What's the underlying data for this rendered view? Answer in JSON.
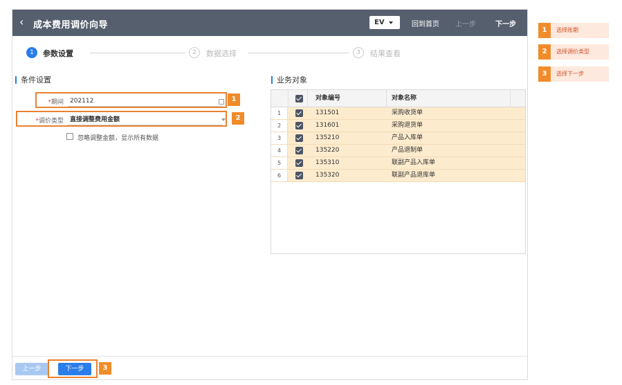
{
  "titlebar": {
    "title": "成本费用调价向导",
    "ev": "EV",
    "home": "回到首页",
    "prev": "上一步",
    "next": "下一步"
  },
  "steps": [
    {
      "num": "1",
      "label": "参数设置",
      "state": "active"
    },
    {
      "num": "2",
      "label": "数据选择",
      "state": "todo"
    },
    {
      "num": "3",
      "label": "结果查看",
      "state": "todo"
    }
  ],
  "conditions": {
    "heading": "条件设置",
    "period_label": "期间",
    "period_value": "202112",
    "type_label": "调价类型",
    "type_value": "直接调整费用金额",
    "req_mark": "*",
    "ignore_label": "忽略调整金额，显示所有数据"
  },
  "objects": {
    "heading": "业务对象",
    "columns": [
      "对象编号",
      "对象名称"
    ],
    "rows": [
      {
        "idx": "1",
        "code": "131501",
        "name": "采购收货单"
      },
      {
        "idx": "2",
        "code": "131601",
        "name": "采购退货单"
      },
      {
        "idx": "3",
        "code": "135210",
        "name": "产品入库单"
      },
      {
        "idx": "4",
        "code": "135220",
        "name": "产品退制单"
      },
      {
        "idx": "5",
        "code": "135310",
        "name": "联副产品入库单"
      },
      {
        "idx": "6",
        "code": "135320",
        "name": "联副产品退库单"
      }
    ]
  },
  "footer": {
    "prev": "上一步",
    "next": "下一步"
  },
  "badges": [
    "1",
    "2",
    "3"
  ],
  "callouts": [
    {
      "num": "1",
      "text": "选择账期"
    },
    {
      "num": "2",
      "text": "选择调价类型"
    },
    {
      "num": "3",
      "text": "选择下一步"
    }
  ],
  "colors": {
    "titlebar": "#565f6e",
    "accent": "#2b7de9",
    "highlight": "#ea8130",
    "row_bg": "#fdebcd"
  }
}
